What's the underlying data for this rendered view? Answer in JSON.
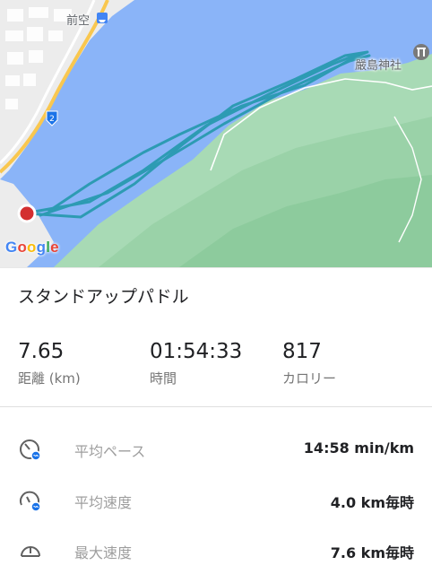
{
  "map": {
    "labels": {
      "top_left": "前空",
      "top_right": "嚴島神社"
    },
    "route_marker": "2",
    "logo": "Google",
    "colors": {
      "water": "#8ab4f8",
      "land": "#a8dab5",
      "route": "#2d9bb3",
      "start_marker": "#d32f2f"
    }
  },
  "activity": {
    "title": "スタンドアップパドル"
  },
  "stats": [
    {
      "value": "7.65",
      "label": "距離 (km)"
    },
    {
      "value": "01:54:33",
      "label": "時間"
    },
    {
      "value": "817",
      "label": "カロリー"
    }
  ],
  "metrics": [
    {
      "icon": "pace-gauge-icon",
      "label": "平均ペース",
      "value": "14:58 min/km"
    },
    {
      "icon": "avg-speed-gauge-icon",
      "label": "平均速度",
      "value": "4.0 km毎時"
    },
    {
      "icon": "max-speed-gauge-icon",
      "label": "最大速度",
      "value": "7.6 km毎時"
    }
  ]
}
